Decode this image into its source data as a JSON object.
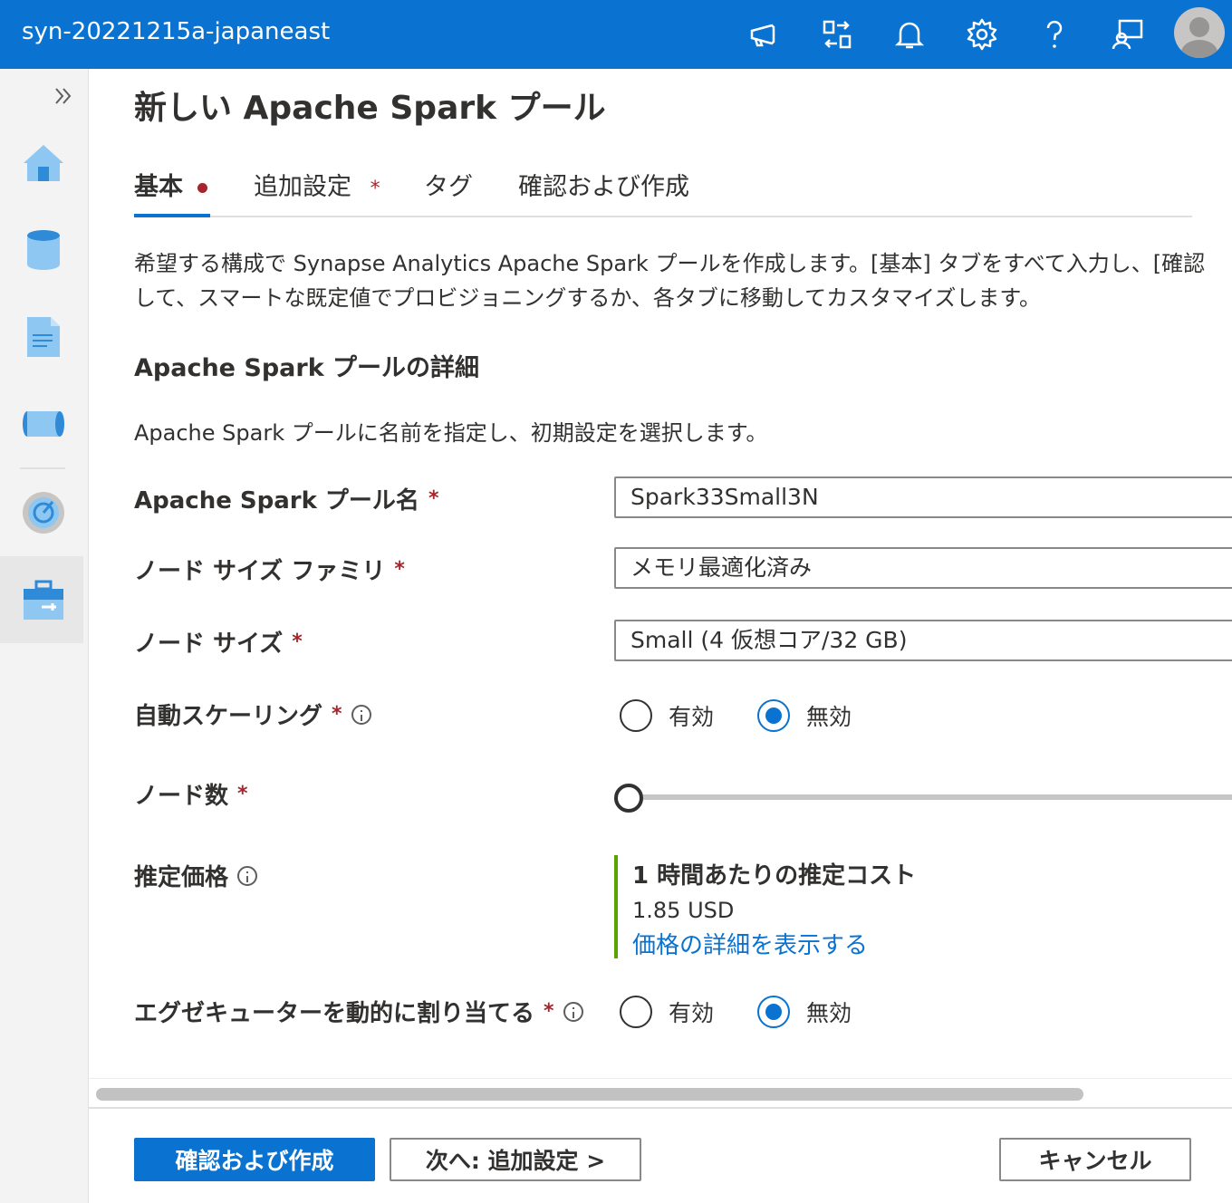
{
  "header": {
    "workspace_name": "syn-20221215a-japaneast",
    "icons": [
      "megaphone-icon",
      "directory-switch-icon",
      "bell-icon",
      "gear-icon",
      "help-icon",
      "feedback-icon",
      "avatar"
    ]
  },
  "sidebar": {
    "items": [
      "expand-icon",
      "home-icon",
      "data-icon",
      "develop-icon",
      "integrate-icon",
      "monitor-icon",
      "manage-icon"
    ]
  },
  "page": {
    "title": "新しい Apache Spark プール"
  },
  "tabs": [
    {
      "label": "基本",
      "active": true
    },
    {
      "label": "追加設定",
      "required": "*"
    },
    {
      "label": "タグ"
    },
    {
      "label": "確認および作成"
    }
  ],
  "description": {
    "line1": "希望する構成で Synapse Analytics Apache Spark プールを作成します。[基本] タブをすべて入力し、[確認",
    "line2": "して、スマートな既定値でプロビジョニングするか、各タブに移動してカスタマイズします。"
  },
  "section": {
    "title": "Apache Spark プールの詳細",
    "description": "Apache Spark プールに名前を指定し、初期設定を選択します。"
  },
  "form": {
    "pool_name": {
      "label": "Apache Spark プール名",
      "value": "Spark33Small3N"
    },
    "node_family": {
      "label": "ノード サイズ ファミリ",
      "value": "メモリ最適化済み"
    },
    "node_size": {
      "label": "ノード サイズ",
      "value": "Small (4 仮想コア/32 GB)"
    },
    "autoscale": {
      "label": "自動スケーリング",
      "option_on": "有効",
      "option_off": "無効",
      "selected": "無効"
    },
    "node_count": {
      "label": "ノード数",
      "slider_value_fraction": 0
    },
    "estimated_price": {
      "label": "推定価格",
      "cost_title": "1 時間あたりの推定コスト",
      "cost_value": "1.85 USD",
      "cost_link": "価格の詳細を表示する"
    },
    "dynamic_executors": {
      "label": "エグゼキューターを動的に割り当てる",
      "option_on": "有効",
      "option_off": "無効",
      "selected": "無効"
    },
    "required_mark": "*"
  },
  "footer": {
    "review_create": "確認および作成",
    "next": "次へ: 追加設定 >",
    "cancel": "キャンセル"
  },
  "colors": {
    "brand_blue": "#0a72d0",
    "required_red": "#a4262c",
    "cost_accent_green": "#57a300"
  }
}
